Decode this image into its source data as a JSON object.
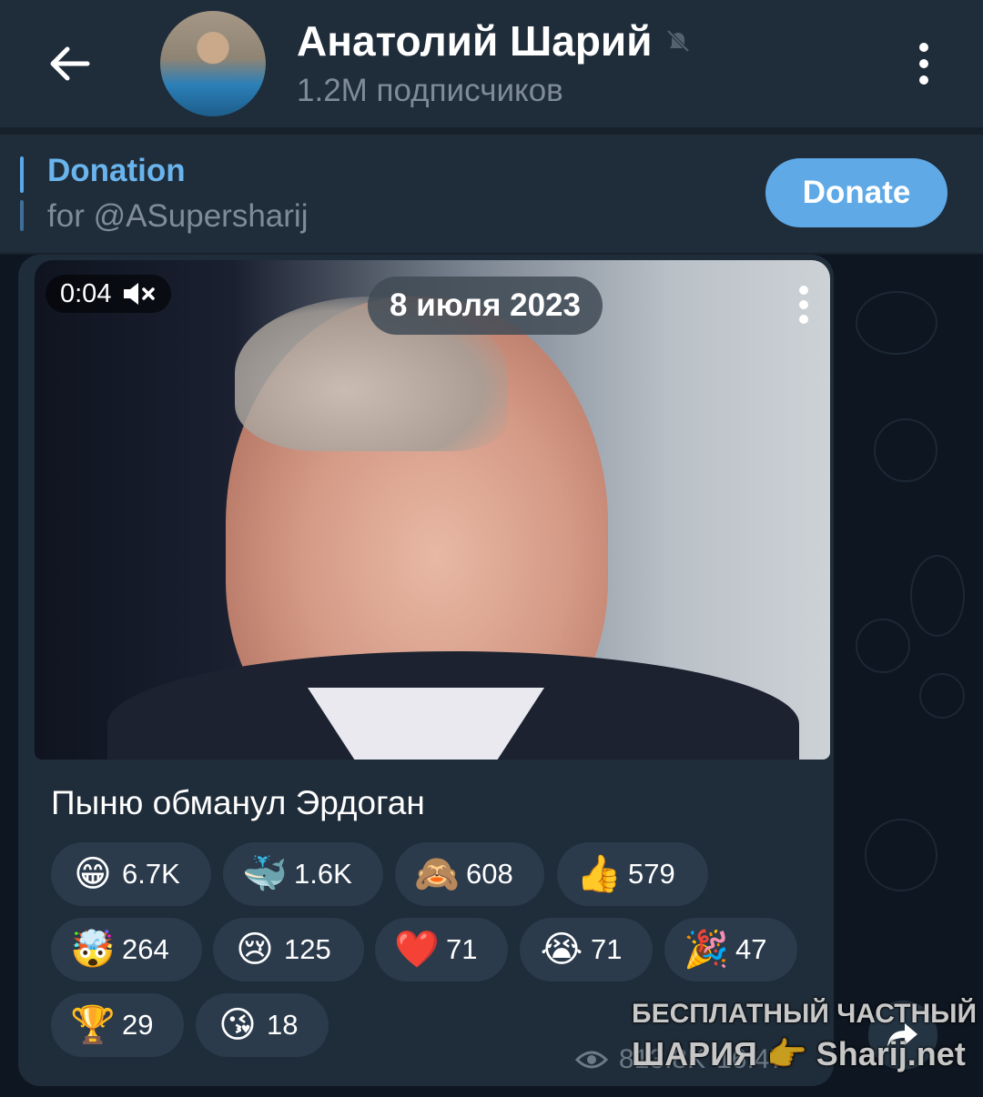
{
  "header": {
    "back_icon": "arrow-left-icon",
    "title": "Анатолий Шарий",
    "subscribers": "1.2M подписчиков",
    "mute_icon": "muted-bell-icon",
    "menu_icon": "kebab-menu-icon"
  },
  "pinned": {
    "title": "Donation",
    "subtitle": "for @ASupersharij",
    "button_label": "Donate"
  },
  "message": {
    "video_time": "0:04",
    "date": "8 июля 2023",
    "caption": "Пыню обманул Эрдоган",
    "reactions": [
      {
        "emoji": "😁",
        "count": "6.7K"
      },
      {
        "emoji": "🐳",
        "count": "1.6K"
      },
      {
        "emoji": "🙈",
        "count": "608"
      },
      {
        "emoji": "👍",
        "count": "579"
      },
      {
        "emoji": "🤯",
        "count": "264"
      },
      {
        "emoji": "😢",
        "count": "125"
      },
      {
        "emoji": "❤️",
        "count": "71"
      },
      {
        "emoji": "😭",
        "count": "71"
      },
      {
        "emoji": "🎉",
        "count": "47"
      },
      {
        "emoji": "🏆",
        "count": "29"
      },
      {
        "emoji": "😘",
        "count": "18"
      }
    ],
    "views": "813.8K",
    "time": "16:47"
  },
  "watermark": {
    "line1": "БЕСПЛАТНЫЙ ЧАСТНЫЙ",
    "line2": "ШАРИЯ 👉 Sharij.net"
  },
  "colors": {
    "header_bg": "#1f2c39",
    "chat_bg": "#0e1621",
    "accent": "#5fa9e6",
    "chip_bg": "#2b3b4c"
  }
}
